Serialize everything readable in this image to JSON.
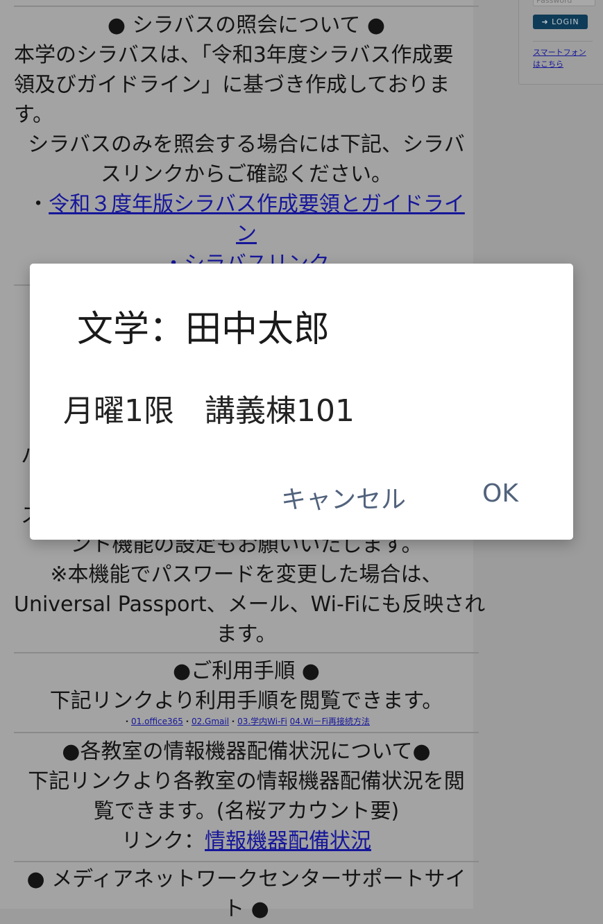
{
  "syllabus": {
    "heading": "● シラバスの照会について ●",
    "p1_l1": "本学のシラバスは、「令和3年度シラバス作成要",
    "p1_l2": "領及びガイドライン」に基づき作成しておりま",
    "p1_l3": "す。",
    "p2_l1": "シラバスのみを照会する場合には下記、シラバ",
    "p2_l2": "スリンクからご確認ください。",
    "bullet": "・",
    "link1_l1": "令和３度年版シラバス作成要領とガイドライ",
    "link1_l2": "ン",
    "link2": "・シラバスリンク"
  },
  "partial": {
    "frag1": "ハ",
    "frag2": "ス",
    "frag3": "ント機能の設定もお願いいたします。"
  },
  "password_note": {
    "l1": "※本機能でパスワードを変更した場合は、",
    "l2": "Universal Passport、メール、Wi-Fiにも反映され",
    "l3": "ます。"
  },
  "usage": {
    "heading": "●ご利用手順 ●",
    "desc": "下記リンクより利用手順を閲覧できます。",
    "links": [
      {
        "prefix": "・",
        "label": "01.office365"
      },
      {
        "prefix": "・",
        "label": "02.Gmail"
      },
      {
        "prefix": "・",
        "label": "03.学内Wi-Fi"
      },
      {
        "prefix": " ",
        "label": "04.Wi－Fi再接続方法"
      }
    ]
  },
  "equipment": {
    "heading": "●各教室の情報機器配備状況について●",
    "l1": "下記リンクより各教室の情報機器配備状況を閲",
    "l2": "覧できます。(名桜アカウント要)",
    "link_prefix": "リンク：",
    "link_label": "情報機器配備状況"
  },
  "support": {
    "heading_l1": "● メディアネットワークセンターサポートサイ",
    "heading_l2": "ト ●"
  },
  "login": {
    "password_placeholder": "Password",
    "login_label": "LOGIN",
    "smartphone_link": "スマートフォンはこちら"
  },
  "dialog": {
    "title": "文学：田中太郎",
    "message": "月曜1限　講義棟101",
    "cancel_label": "キャンセル",
    "ok_label": "OK"
  },
  "colors": {
    "overlay_page": "#a3a3a3",
    "link": "#16169a",
    "dialog_button": "#51627c",
    "login_button": "#0e3b57"
  }
}
